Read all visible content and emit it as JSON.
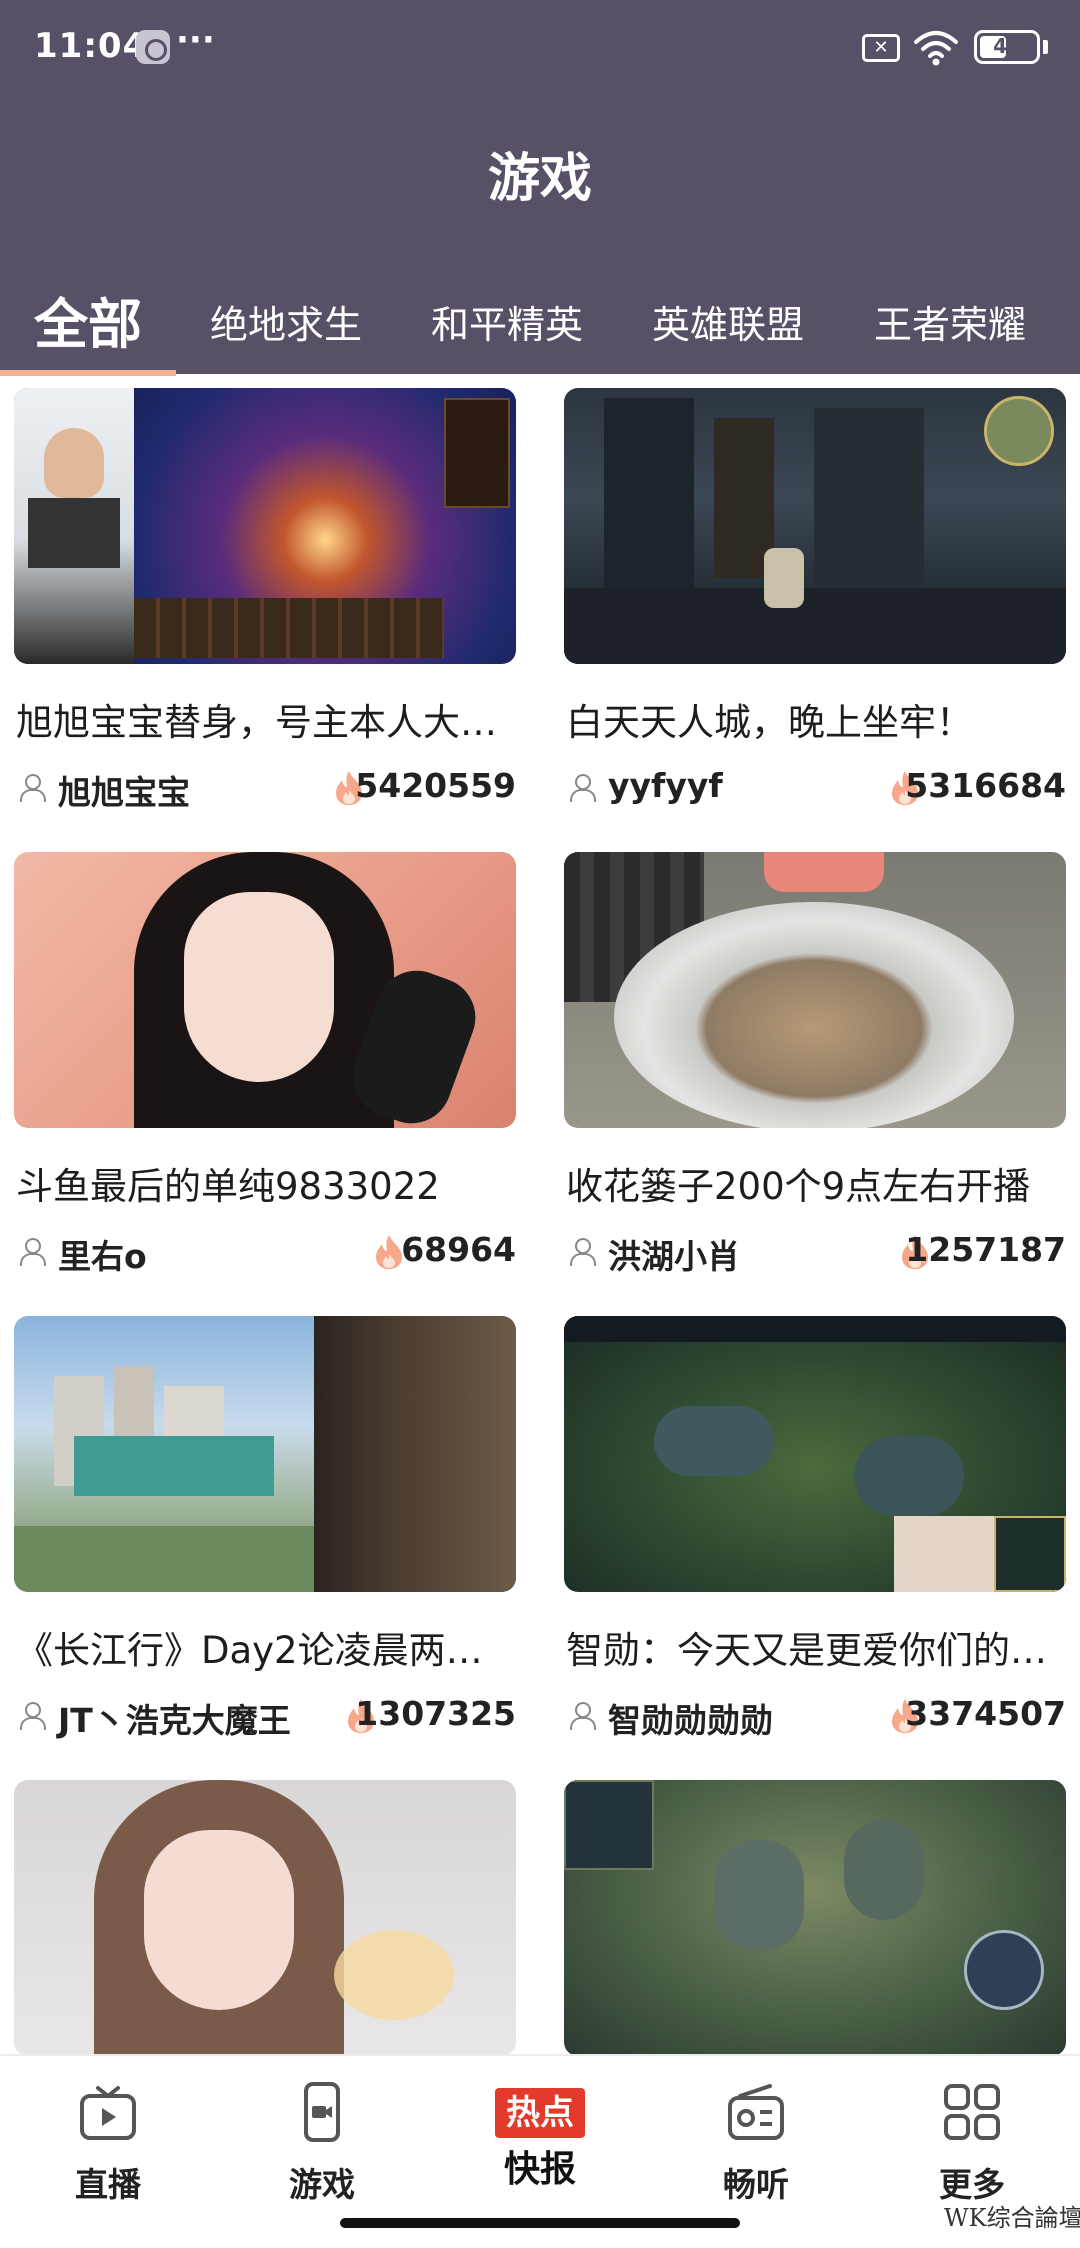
{
  "status_bar": {
    "time": "11:04",
    "dots": "···",
    "battery": "42"
  },
  "header": {
    "title": "游戏"
  },
  "tabs": [
    {
      "label": "全部",
      "active": true
    },
    {
      "label": "绝地求生",
      "active": false
    },
    {
      "label": "和平精英",
      "active": false
    },
    {
      "label": "英雄联盟",
      "active": false
    },
    {
      "label": "王者荣耀",
      "active": false
    }
  ],
  "cards": [
    {
      "title": "旭旭宝宝替身，号主本人大…",
      "author": "旭旭宝宝",
      "heat": "5420559",
      "thumb": "arpg-boss-fight-stream"
    },
    {
      "title": "白天天人城，晚上坐牢！",
      "author": "yyfyyf",
      "heat": "5316684",
      "thumb": "dark-stone-building-game"
    },
    {
      "title": "斗鱼最后的单纯9833022",
      "author": "里右o",
      "heat": "68964",
      "thumb": "girl-with-microphone"
    },
    {
      "title": "收花篓子200个9点左右开播",
      "author": "洪湖小肖",
      "heat": "1257187",
      "thumb": "metal-basin-outdoor"
    },
    {
      "title": "《长江行》Day2论凌晨两点…",
      "author": "JT丶浩克大魔王",
      "heat": "1307325",
      "thumb": "city-view-outdoor-stream"
    },
    {
      "title": "智勋：今天又是更爱你们的…",
      "author": "智勋勋勋勋",
      "heat": "3374507",
      "thumb": "moba-map-gameplay"
    },
    {
      "title": "",
      "author": "",
      "heat": "",
      "thumb": "girl-selfie-stream"
    },
    {
      "title": "",
      "author": "",
      "heat": "",
      "thumb": "honor-of-kings-gameplay"
    }
  ],
  "bottom_nav": {
    "items": [
      {
        "label": "直播",
        "icon": "tv-icon"
      },
      {
        "label": "游戏",
        "icon": "phone-video-icon"
      },
      {
        "label": "热点",
        "sub": "快报",
        "icon": "hot-news-badge"
      },
      {
        "label": "畅听",
        "icon": "radio-icon"
      },
      {
        "label": "更多",
        "icon": "grid-icon"
      }
    ]
  },
  "watermark": "WK综合論壇",
  "colors": {
    "header_bg": "#585066",
    "tab_underline": "#f2b08f",
    "hot_badge": "#e33a2c",
    "fire": "#f7a88a"
  }
}
